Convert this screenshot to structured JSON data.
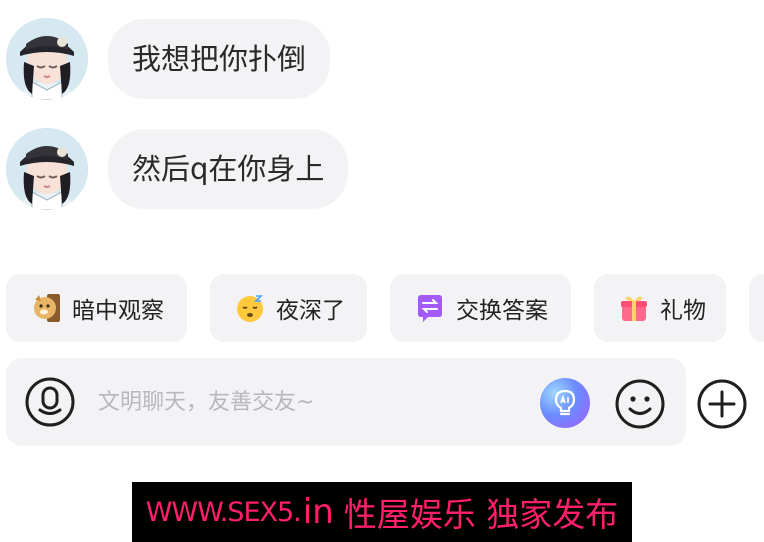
{
  "messages": [
    {
      "text": "我想把你扑倒",
      "avatar": "girl-avatar-icon"
    },
    {
      "text": "然后q在你身上",
      "avatar": "girl-avatar-icon"
    }
  ],
  "chips": [
    {
      "label": "暗中观察",
      "icon": "doge-peek-icon"
    },
    {
      "label": "夜深了",
      "icon": "sleepy-face-icon"
    },
    {
      "label": "交换答案",
      "icon": "exchange-icon",
      "accent": "#a35bff"
    },
    {
      "label": "礼物",
      "icon": "gift-icon",
      "accent": "#ff5a7a"
    }
  ],
  "composer": {
    "placeholder": "文明聊天，友善交友~",
    "value": "",
    "voice_icon": "voice-icon",
    "ai_icon": "ai-lightbulb-icon",
    "emoji_icon": "smiley-icon",
    "plus_icon": "plus-icon"
  },
  "watermark": {
    "part1": "WWW.SEX5.",
    "part2": "in",
    "part3": "性屋娱乐 独家发布"
  },
  "colors": {
    "bubble_bg": "#f3f3f5",
    "watermark_text": "#ff1f6b",
    "watermark_bg": "#000000"
  }
}
